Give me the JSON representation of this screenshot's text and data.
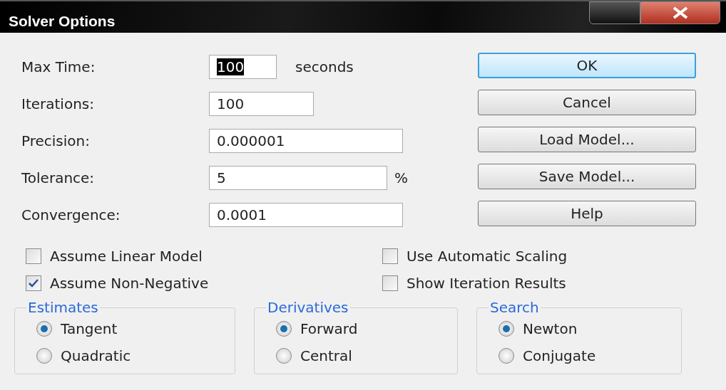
{
  "window": {
    "title": "Solver Options"
  },
  "fields": [
    {
      "label": "Max Time:",
      "value": "100",
      "value_selected": true,
      "suffix": "seconds"
    },
    {
      "label": "Iterations:",
      "value": "100",
      "value_selected": false
    },
    {
      "label": "Precision:",
      "value": "0.000001",
      "value_selected": false
    },
    {
      "label": "Tolerance:",
      "value": "5",
      "value_selected": false,
      "suffix": "%"
    },
    {
      "label": "Convergence:",
      "value": "0.0001",
      "value_selected": false
    }
  ],
  "buttons": [
    {
      "label": "OK",
      "default": true
    },
    {
      "label": "Cancel",
      "default": false
    },
    {
      "label": "Load Model...",
      "default": false
    },
    {
      "label": "Save Model...",
      "default": false
    },
    {
      "label": "Help",
      "default": false
    }
  ],
  "checkboxes": [
    {
      "label": "Assume Linear Model",
      "checked": false
    },
    {
      "label": "Use Automatic Scaling",
      "checked": false
    },
    {
      "label": "Assume Non-Negative",
      "checked": true
    },
    {
      "label": "Show Iteration Results",
      "checked": false
    }
  ],
  "groups": [
    {
      "title": "Estimates",
      "options": [
        {
          "label": "Tangent",
          "selected": true
        },
        {
          "label": "Quadratic",
          "selected": false
        }
      ]
    },
    {
      "title": "Derivatives",
      "options": [
        {
          "label": "Forward",
          "selected": true
        },
        {
          "label": "Central",
          "selected": false
        }
      ]
    },
    {
      "title": "Search",
      "options": [
        {
          "label": "Newton",
          "selected": true
        },
        {
          "label": "Conjugate",
          "selected": false
        }
      ]
    }
  ]
}
